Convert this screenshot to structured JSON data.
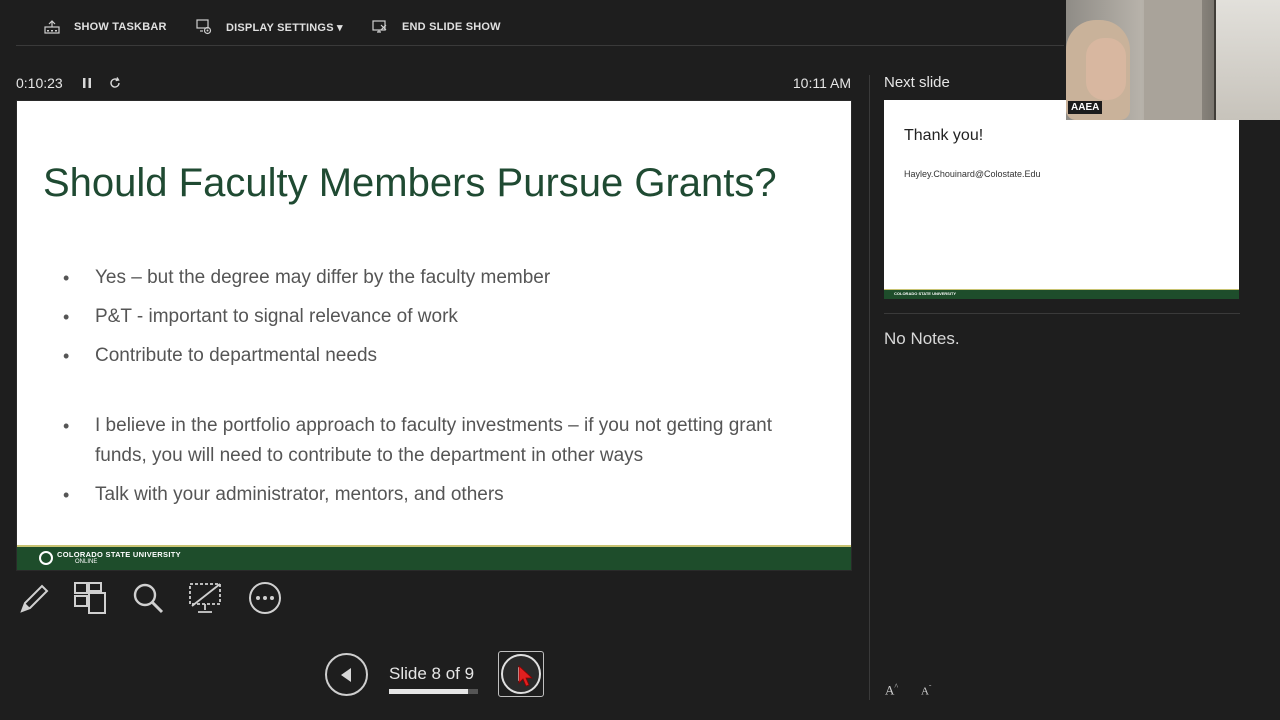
{
  "toolbar": {
    "show_taskbar": "SHOW TASKBAR",
    "display_settings": "DISPLAY SETTINGS ▾",
    "end_slide_show": "END SLIDE SHOW"
  },
  "timer": {
    "elapsed": "0:10:23",
    "clock": "10:11 AM"
  },
  "slide": {
    "title": "Should Faculty Members Pursue Grants?",
    "bullets": [
      "Yes – but the degree may differ by the faculty member",
      "P&T - important to signal relevance of work",
      "Contribute to departmental needs",
      "I believe in the portfolio approach to faculty investments – if you not getting grant funds, you will need to contribute to the department in other ways",
      "Talk with your administrator, mentors, and others"
    ],
    "footer_org": "COLORADO STATE UNIVERSITY",
    "footer_sub": "ONLINE"
  },
  "navigator": {
    "counter": "Slide 8 of 9",
    "progress": 0.889
  },
  "next_slide": {
    "label": "Next slide",
    "title": "Thank you!",
    "email": "Hayley.Chouinard@Colostate.Edu",
    "footer_org": "COLORADO STATE UNIVERSITY"
  },
  "notes": {
    "text": "No Notes."
  },
  "font_controls": {
    "increase": "A",
    "decrease": "A"
  },
  "webcam": {
    "participant": "AAEA"
  },
  "colors": {
    "background": "#1e1e1e",
    "slide_title": "#1f4a32",
    "footer_green": "#1e4d2b",
    "footer_gold": "#c8c372"
  },
  "icons": [
    "taskbar-icon",
    "display-settings-icon",
    "end-show-icon",
    "pause-icon",
    "restart-icon",
    "pen-icon",
    "slides-grid-icon",
    "magnifier-icon",
    "black-screen-icon",
    "more-options-icon",
    "previous-icon",
    "next-icon"
  ]
}
